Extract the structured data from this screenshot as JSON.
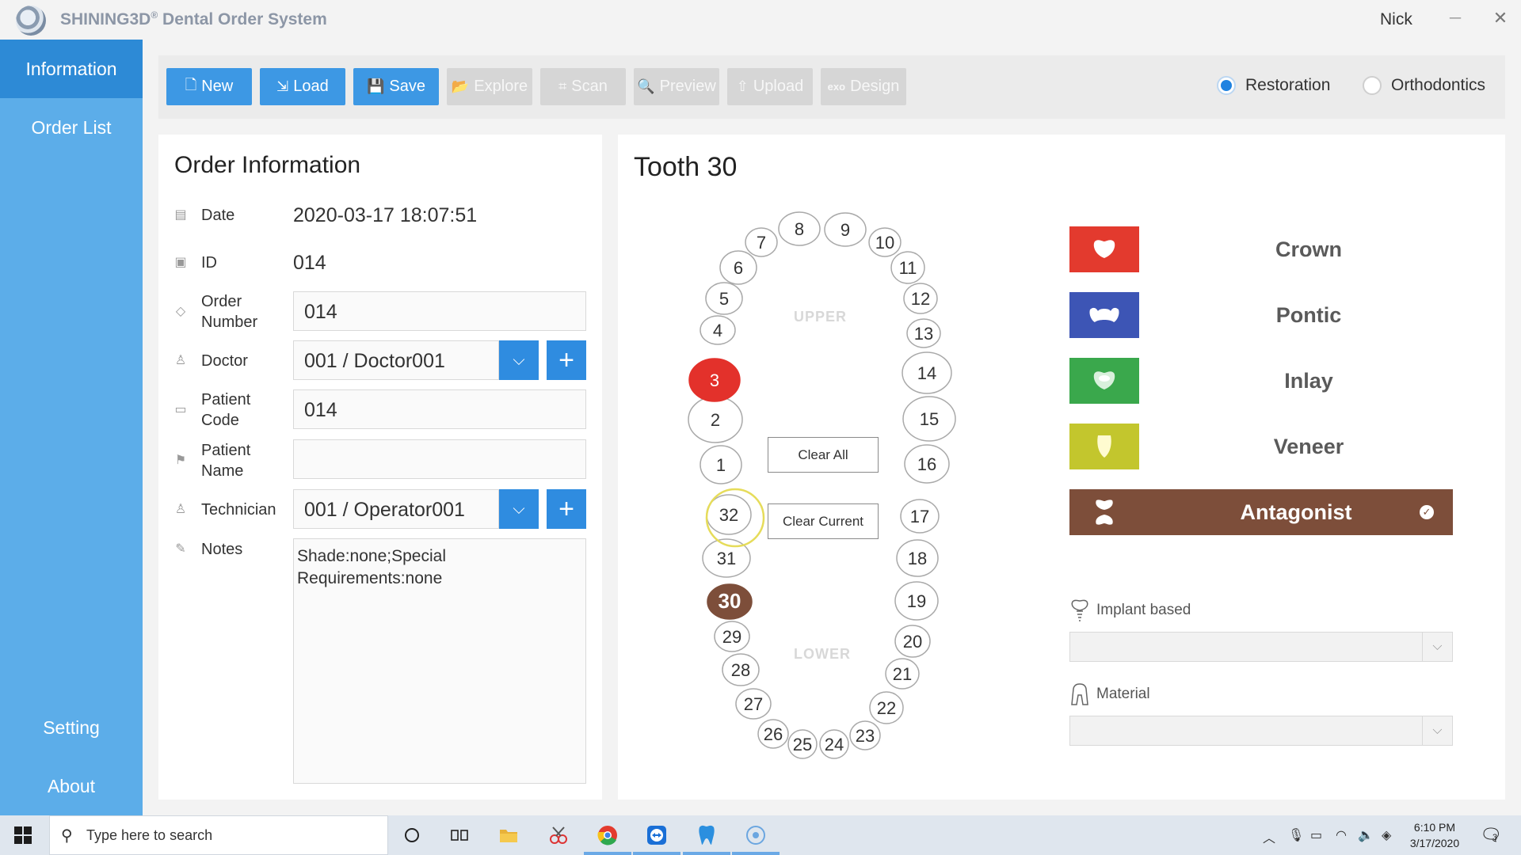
{
  "window": {
    "brand": "SHINING3D",
    "reg_mark": "®",
    "title_rest": " Dental Order System",
    "user": "Nick",
    "minimize_glyph": "─",
    "close_glyph": "✕"
  },
  "sidebar": {
    "items": [
      {
        "label": "Information",
        "active": true
      },
      {
        "label": "Order List",
        "active": false
      },
      {
        "label": "Setting",
        "active": false
      },
      {
        "label": "About",
        "active": false
      }
    ]
  },
  "toolbar": {
    "buttons": [
      {
        "label": "New",
        "icon": "file-icon",
        "glyph": "🗋",
        "enabled": true
      },
      {
        "label": "Load",
        "icon": "load-icon",
        "glyph": "⇲",
        "enabled": true
      },
      {
        "label": "Save",
        "icon": "save-icon",
        "glyph": "💾",
        "enabled": true
      },
      {
        "label": "Explore",
        "icon": "folder-icon",
        "glyph": "📂",
        "enabled": false
      },
      {
        "label": "Scan",
        "icon": "scan-icon",
        "glyph": "⌗",
        "enabled": false
      },
      {
        "label": "Preview",
        "icon": "preview-icon",
        "glyph": "🔍",
        "enabled": false
      },
      {
        "label": "Upload",
        "icon": "upload-icon",
        "glyph": "⇧",
        "enabled": false
      },
      {
        "label": "Design",
        "icon": "exo-icon",
        "glyph": "exo",
        "enabled": false
      }
    ],
    "mode": {
      "options": [
        "Restoration",
        "Orthodontics"
      ],
      "selected": "Restoration"
    }
  },
  "order": {
    "title": "Order Information",
    "date_label": "Date",
    "date_value": "2020-03-17 18:07:51",
    "id_label": "ID",
    "id_value": "014",
    "order_number_label_1": "Order",
    "order_number_label_2": "Number",
    "order_number_value": "014",
    "doctor_label": "Doctor",
    "doctor_value": "001 / Doctor001",
    "patient_code_label_1": "Patient",
    "patient_code_label_2": "Code",
    "patient_code_value": "014",
    "patient_name_label_1": "Patient",
    "patient_name_label_2": "Name",
    "patient_name_value": "",
    "technician_label": "Technician",
    "technician_value": "001 / Operator001",
    "notes_label": "Notes",
    "notes_value": "Shade:none;Special Requirements:none"
  },
  "tooth_chart": {
    "title": "Tooth 30",
    "upper_label": "UPPER",
    "lower_label": "LOWER",
    "clear_all": "Clear All",
    "clear_current": "Clear Current",
    "selected_tooth": "30",
    "marked_tooth": "3",
    "teeth": [
      "1",
      "2",
      "3",
      "4",
      "5",
      "6",
      "7",
      "8",
      "9",
      "10",
      "11",
      "12",
      "13",
      "14",
      "15",
      "16",
      "17",
      "18",
      "19",
      "20",
      "21",
      "22",
      "23",
      "24",
      "25",
      "26",
      "27",
      "28",
      "29",
      "30",
      "31",
      "32"
    ],
    "colors": {
      "selected": "#7d4e3a",
      "marked": "#e3312b",
      "hover_ring": "#e6dc5a"
    }
  },
  "restoration_types": [
    {
      "name": "Crown",
      "color": "#e33a2e",
      "active": false
    },
    {
      "name": "Pontic",
      "color": "#3d55b5",
      "active": false
    },
    {
      "name": "Inlay",
      "color": "#3aa84c",
      "active": false
    },
    {
      "name": "Veneer",
      "color": "#c3c62d",
      "active": false
    },
    {
      "name": "Antagonist",
      "color": "#7d4e3a",
      "active": true
    }
  ],
  "implant": {
    "label": "Implant based",
    "value": ""
  },
  "material": {
    "label": "Material",
    "value": ""
  },
  "taskbar": {
    "search_placeholder": "Type here to search",
    "time": "6:10 PM",
    "date": "3/17/2020",
    "notification_count": "3"
  }
}
